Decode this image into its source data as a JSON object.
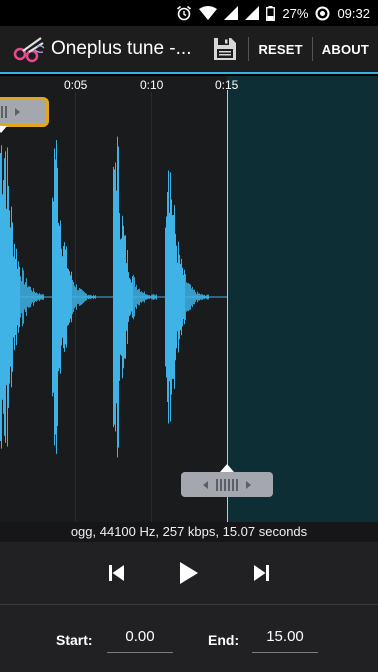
{
  "status_bar": {
    "battery_percent": "27%",
    "time": "09:32",
    "icons": [
      "alarm-icon",
      "wifi-icon",
      "signal-icon",
      "signal-icon",
      "battery-icon",
      "data-saver-icon"
    ]
  },
  "action_bar": {
    "title": "Oneplus tune -...",
    "save_icon": "floppy-disk-icon",
    "reset_label": "RESET",
    "about_label": "ABOUT",
    "accent_color": "#33b5e5"
  },
  "waveform": {
    "time_labels": [
      "0:05",
      "0:10",
      "0:15"
    ],
    "wave_color": "#3fb3e6",
    "selection_start_seconds": 0.0,
    "selection_end_seconds": 15.0
  },
  "file_info": "ogg, 44100 Hz, 257 kbps, 15.07 seconds",
  "transport": {
    "prev_icon": "skip-previous-icon",
    "play_icon": "play-icon",
    "next_icon": "skip-next-icon"
  },
  "range": {
    "start_label": "Start:",
    "start_value": "0.00",
    "end_label": "End:",
    "end_value": "15.00"
  }
}
